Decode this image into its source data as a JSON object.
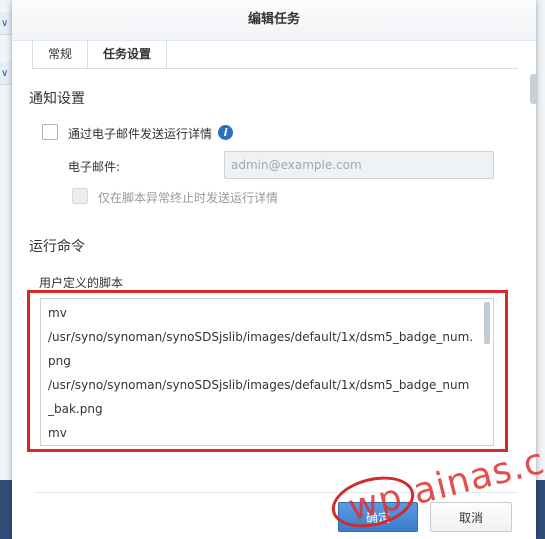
{
  "dialog": {
    "title": "编辑任务"
  },
  "tabs": [
    {
      "label": "常规"
    },
    {
      "label": "任务设置"
    }
  ],
  "notify": {
    "section_title": "通知设置",
    "send_email_label": "通过电子邮件发送运行详情",
    "email_label": "电子邮件:",
    "email_placeholder": "admin@example.com",
    "only_abnormal_label": "仅在脚本异常终止时发送运行详情"
  },
  "run": {
    "section_title": "运行命令",
    "script_label": "用户定义的脚本",
    "script_lines": [
      "mv",
      "/usr/syno/synoman/synoSDSjslib/images/default/1x/dsm5_badge_num.",
      "png",
      "/usr/syno/synoman/synoSDSjslib/images/default/1x/dsm5_badge_num",
      "_bak.png",
      "mv"
    ]
  },
  "footer": {
    "ok_label": "确定",
    "cancel_label": "取消"
  },
  "watermark": "wp.ainas.cc",
  "colors": {
    "accent": "#3b7dcc",
    "annotation": "#d42a2a"
  }
}
